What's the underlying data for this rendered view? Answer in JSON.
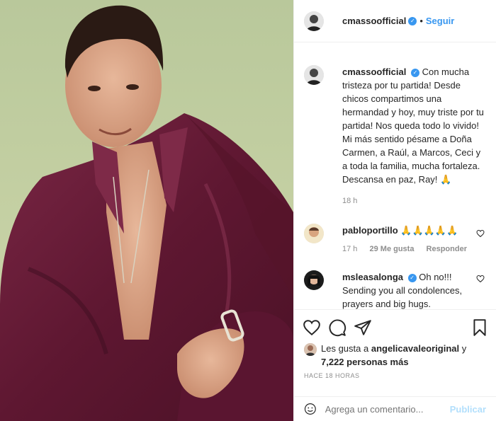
{
  "header": {
    "username": "cmassoofficial",
    "separator": "•",
    "follow_label": "Seguir"
  },
  "caption": {
    "username": "cmassoofficial",
    "text": "Con mucha tristeza por tu partida! Desde chicos compartimos una hermandad y hoy, muy triste por tu partida! Nos queda todo lo vivido! Mi más sentido pésame a Doña Carmen, a Raúl, a Marcos, Ceci y a toda la familia, mucha fortaleza. Descansa en paz, Ray! 🙏",
    "time": "18 h"
  },
  "comments": [
    {
      "username": "pabloportillo",
      "text": "🙏🙏🙏🙏🙏",
      "time": "17 h",
      "likes": "29 Me gusta",
      "reply_label": "Responder"
    },
    {
      "username": "msleasalonga",
      "text": "Oh no!!! Sending you all condolences, prayers and big hugs."
    }
  ],
  "likes": {
    "prefix": "Les gusta a",
    "user": "angelicavaleoriginal",
    "connector": "y",
    "count": "7,222 personas más"
  },
  "posted_ago": "HACE 18 HORAS",
  "add_comment": {
    "placeholder": "Agrega un comentario...",
    "publish_label": "Publicar"
  },
  "icons": {
    "like": "heart-icon",
    "comment": "comment-icon",
    "share": "share-icon",
    "save": "bookmark-icon",
    "emoji": "emoji-icon",
    "verified": "verified-badge-icon"
  },
  "colors": {
    "accent": "#3897f0",
    "publish_disabled": "#b2dffc",
    "muted": "#8e8e8e",
    "shirt": "#6b1f3a"
  }
}
